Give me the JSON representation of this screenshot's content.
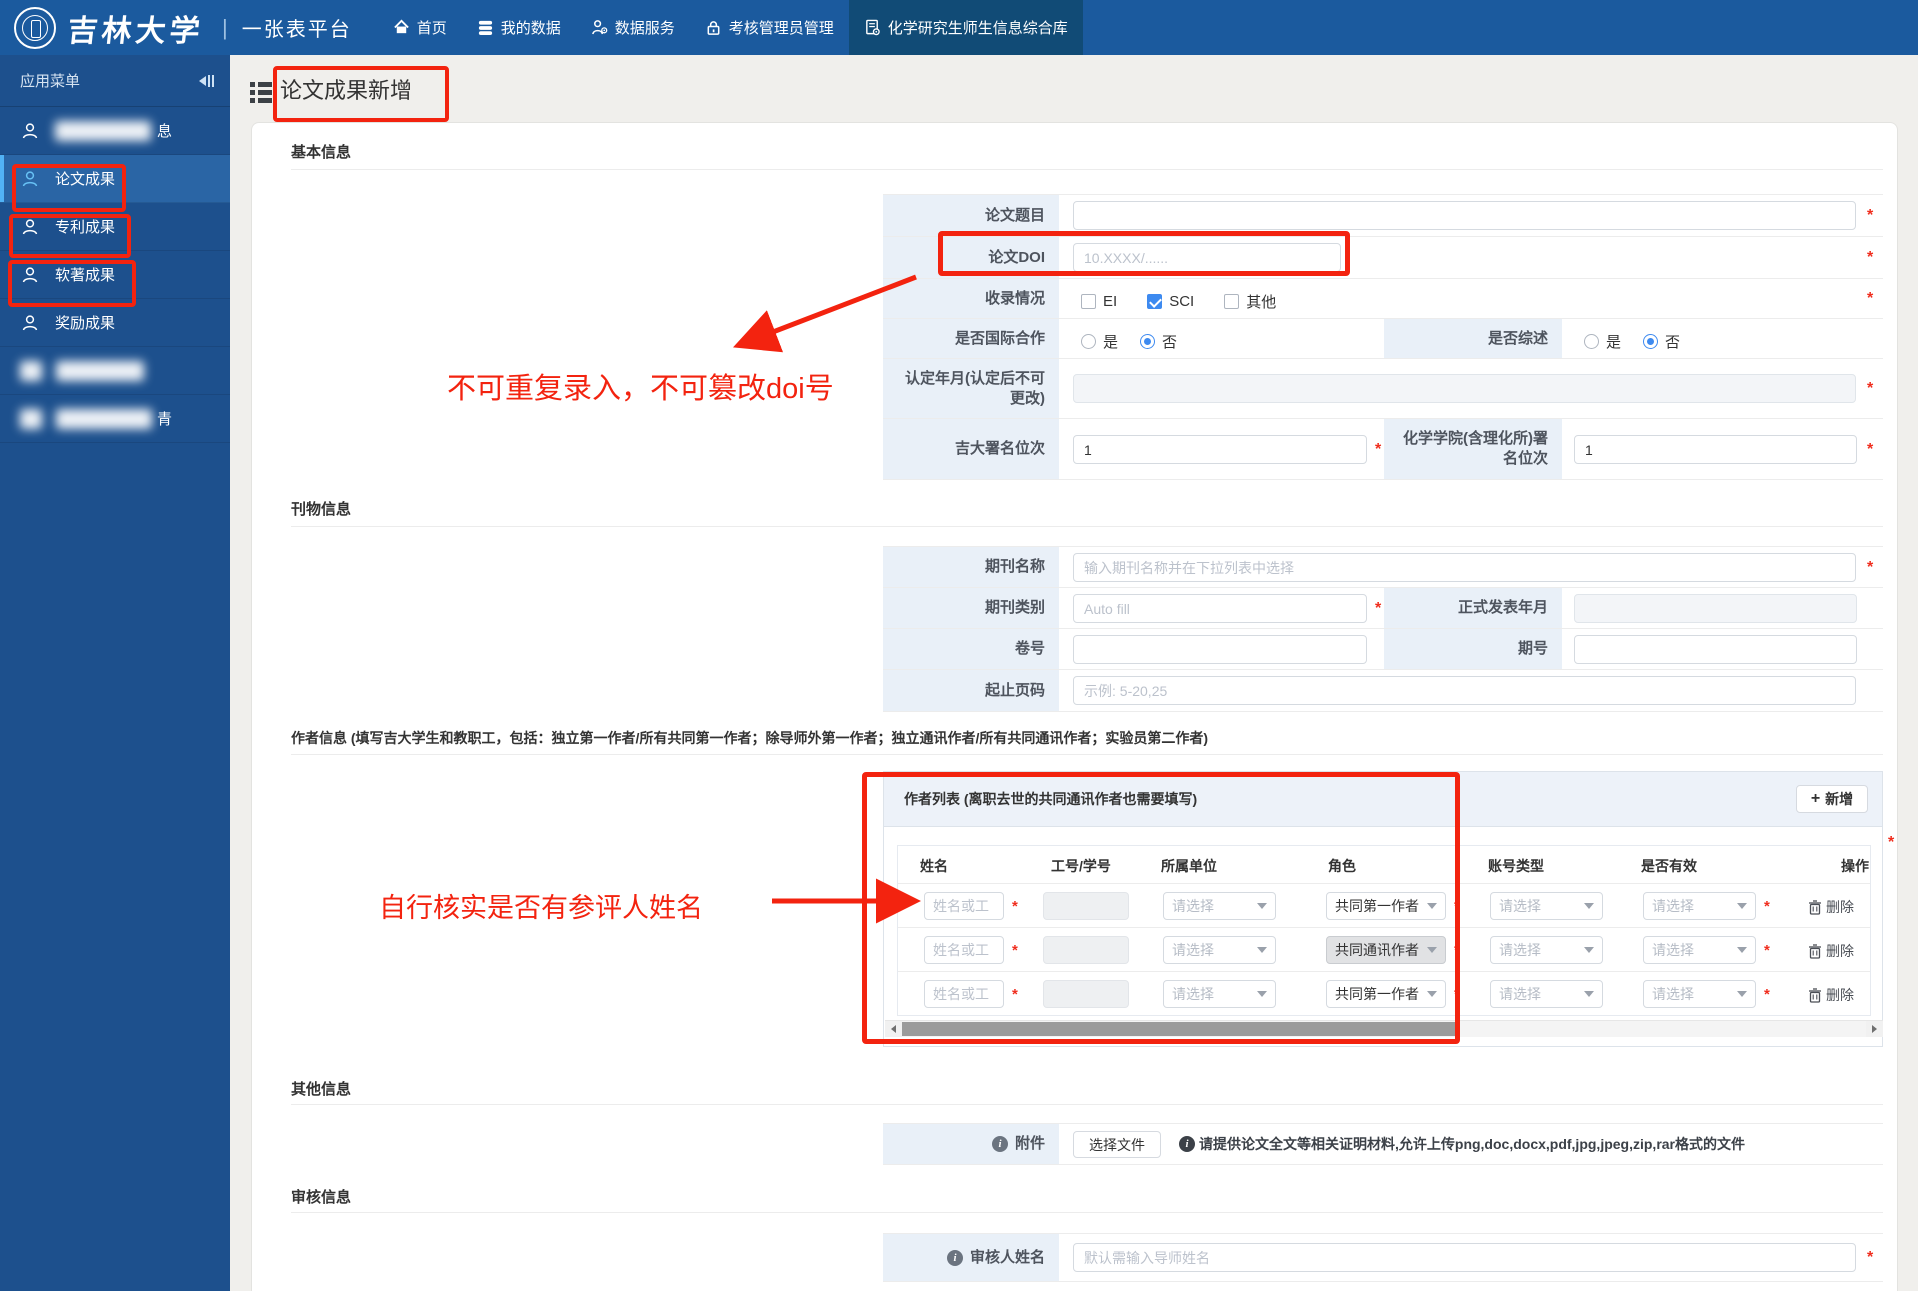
{
  "navbar": {
    "university": "吉林大学",
    "divider": "|",
    "platform": "一张表平台",
    "items": [
      {
        "icon": "home-icon",
        "label": "首页",
        "active": false
      },
      {
        "icon": "database-icon",
        "label": "我的数据",
        "active": false
      },
      {
        "icon": "user-service-icon",
        "label": "数据服务",
        "active": false
      },
      {
        "icon": "lock-icon",
        "label": "考核管理员管理",
        "active": false
      },
      {
        "icon": "document-gear-icon",
        "label": "化学研究生师生信息综合库",
        "active": true
      }
    ]
  },
  "sidebar": {
    "header": "应用菜单",
    "items": [
      {
        "label": "",
        "redacted": true,
        "suffix": "息",
        "active": false,
        "annotated": false
      },
      {
        "label": "论文成果",
        "redacted": false,
        "active": true,
        "annotated": true
      },
      {
        "label": "专利成果",
        "redacted": false,
        "active": false,
        "annotated": true
      },
      {
        "label": "软著成果",
        "redacted": false,
        "active": false,
        "annotated": true
      },
      {
        "label": "奖励成果",
        "redacted": false,
        "active": false,
        "annotated": false
      },
      {
        "label": "",
        "redacted": true,
        "suffix": "",
        "active": false,
        "annotated": false
      },
      {
        "label": "",
        "redacted": true,
        "suffix": "青",
        "active": false,
        "annotated": false
      }
    ]
  },
  "page": {
    "title": "论文成果新增"
  },
  "form": {
    "basic": {
      "title": "基本信息",
      "paper_title": {
        "label": "论文题目",
        "value": "",
        "required": true
      },
      "doi": {
        "label": "论文DOI",
        "placeholder": "10.XXXX/......",
        "required": true
      },
      "indexed": {
        "label": "收录情况",
        "required": true,
        "options": [
          {
            "label": "EI",
            "checked": false
          },
          {
            "label": "SCI",
            "checked": true
          },
          {
            "label": "其他",
            "checked": false
          }
        ]
      },
      "intl": {
        "label": "是否国际合作",
        "options": [
          {
            "label": "是",
            "selected": false
          },
          {
            "label": "否",
            "selected": true
          }
        ]
      },
      "survey": {
        "label": "是否综述",
        "options": [
          {
            "label": "是",
            "selected": false
          },
          {
            "label": "否",
            "selected": true
          }
        ]
      },
      "confirm_month": {
        "label_line1": "认定年月(认定后不可",
        "label_line2": "更改)",
        "value": "",
        "required": true
      },
      "jlu_rank": {
        "label": "吉大署名位次",
        "value": "1",
        "required": true
      },
      "chem_rank": {
        "label_line1": "化学学院(含理化所)署",
        "label_line2": "名位次",
        "value": "1",
        "required": true
      }
    },
    "journal": {
      "title": "刊物信息",
      "name": {
        "label": "期刊名称",
        "placeholder": "输入期刊名称并在下拉列表中选择",
        "required": true
      },
      "type": {
        "label": "期刊类别",
        "placeholder": "Auto fill",
        "required": true
      },
      "pub_month": {
        "label": "正式发表年月",
        "value": ""
      },
      "volume": {
        "label": "卷号",
        "value": ""
      },
      "issue": {
        "label": "期号",
        "value": ""
      },
      "pages": {
        "label": "起止页码",
        "placeholder": "示例: 5-20,25"
      }
    },
    "authors": {
      "section_title": "作者信息 (填写吉大学生和教职工，包括：独立第一作者/所有共同第一作者；除导师外第一作者；独立通讯作者/所有共同通讯作者；实验员第二作者)",
      "list_title": "作者列表 (离职去世的共同通讯作者也需要填写)",
      "add_button": "新增",
      "columns": [
        "姓名",
        "工号/学号",
        "所属单位",
        "角色",
        "账号类型",
        "是否有效",
        "操作"
      ],
      "name_placeholder": "姓名或工",
      "select_placeholder": "请选择",
      "delete_label": "删除",
      "rows": [
        {
          "role": "共同第一作者",
          "role_disabled": false
        },
        {
          "role": "共同通讯作者",
          "role_disabled": true
        },
        {
          "role": "共同第一作者",
          "role_disabled": false
        }
      ]
    },
    "other": {
      "title": "其他信息",
      "attachment_label": "附件",
      "choose_file": "选择文件",
      "note": "请提供论文全文等相关证明材料,允许上传png,doc,docx,pdf,jpg,jpeg,zip,rar格式的文件"
    },
    "review": {
      "title": "审核信息",
      "reviewer_label": "审核人姓名",
      "placeholder": "默认需输入导师姓名",
      "required": true
    }
  },
  "annotations": {
    "doi_note": "不可重复录入，不可篡改doi号",
    "author_note": "自行核实是否有参评人姓名"
  },
  "colors": {
    "accent_red": "#f3230f",
    "primary_blue": "#3d8af0",
    "navbar_blue": "#1b5a9e",
    "sidebar_blue": "#1d508d",
    "label_cell": "#e9f0f8"
  }
}
